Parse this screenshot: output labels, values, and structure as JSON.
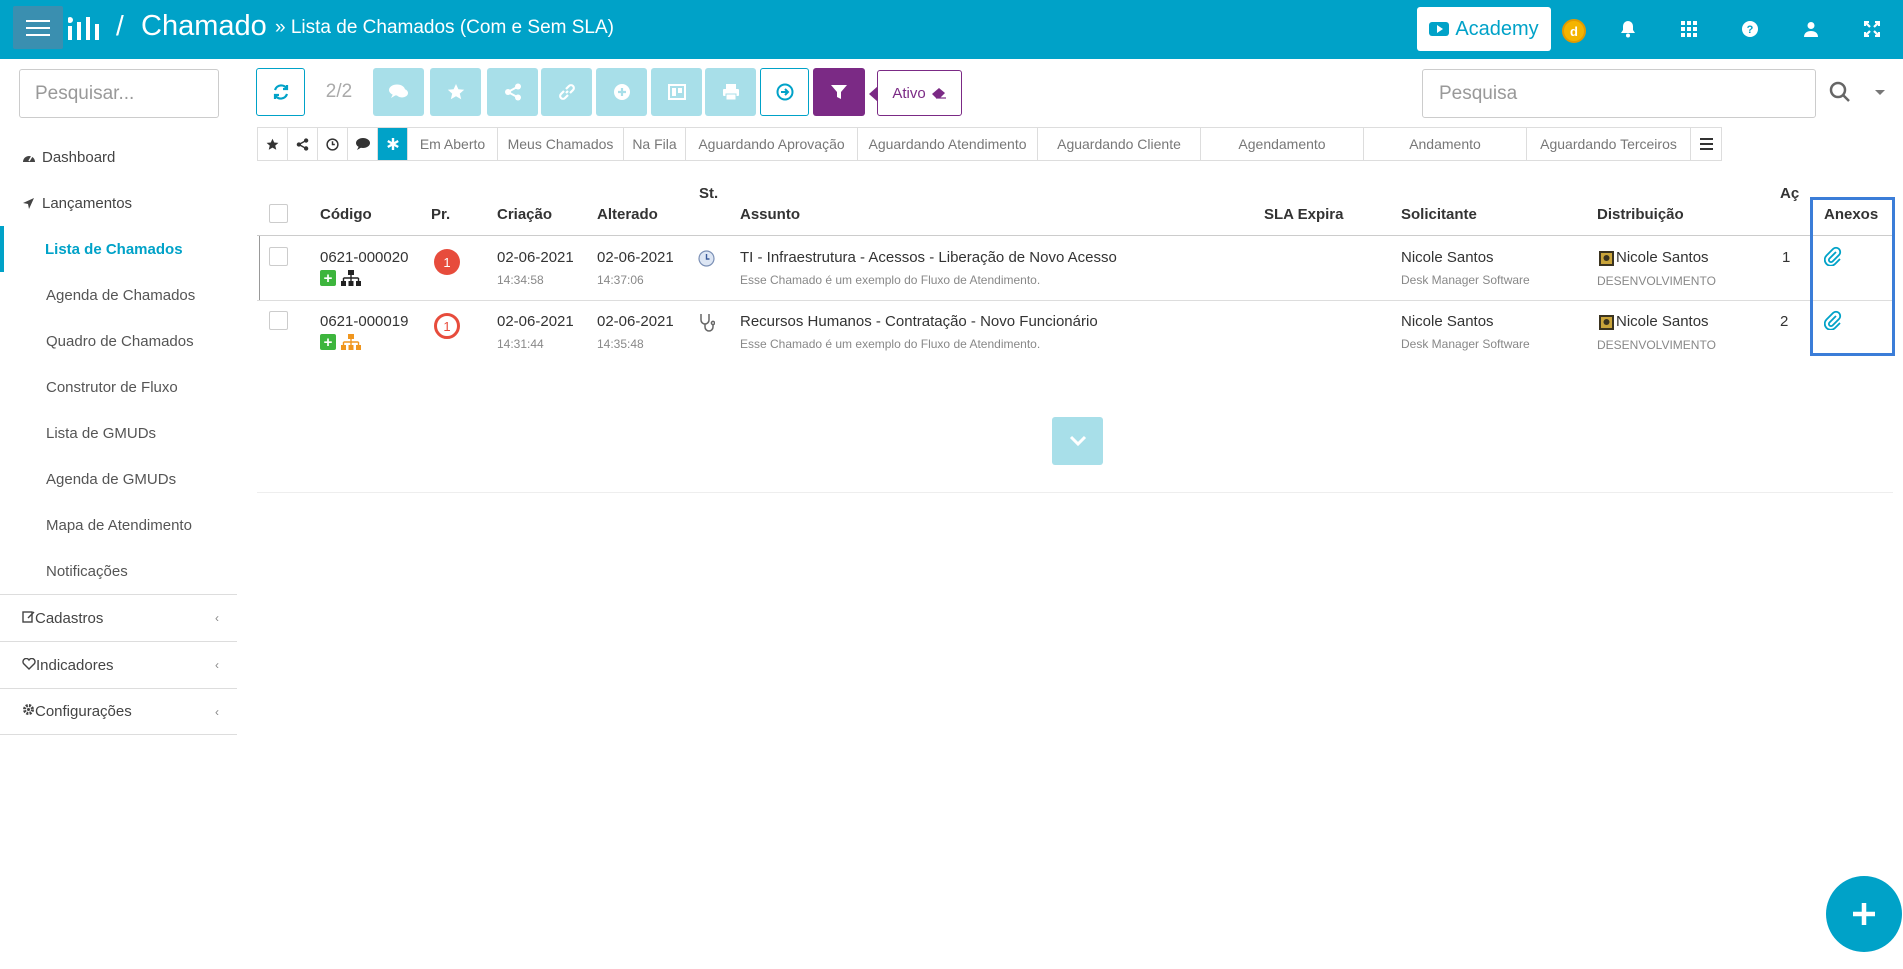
{
  "header": {
    "slash": "/",
    "app_title": "Chamado",
    "breadcrumb": "» Lista de Chamados (Com e Sem SLA)",
    "academy_label": "Academy",
    "coin_label": "d",
    "icons": [
      "bell-icon",
      "grid-icon",
      "question-icon",
      "user-icon",
      "fullscreen-icon"
    ]
  },
  "sidebar": {
    "search_placeholder": "Pesquisar...",
    "dashboard": "Dashboard",
    "lancamentos": "Lançamentos",
    "sub_items": [
      "Lista de Chamados",
      "Agenda de Chamados",
      "Quadro de Chamados",
      "Construtor de Fluxo",
      "Lista de GMUDs",
      "Agenda de GMUDs",
      "Mapa de Atendimento",
      "Notificações"
    ],
    "active_item": "Lista de Chamados",
    "groups": [
      "Cadastros",
      "Indicadores",
      "Configurações"
    ]
  },
  "toolbar": {
    "page_count": "2/2",
    "filter_status": "Ativo",
    "search_placeholder": "Pesquisa"
  },
  "filter_tabs": [
    "Em Aberto",
    "Meus Chamados",
    "Na Fila",
    "Aguardando Aprovação",
    "Aguardando Atendimento",
    "Aguardando Cliente",
    "Agendamento",
    "Andamento",
    "Aguardando Terceiros"
  ],
  "table": {
    "headers": {
      "codigo": "Código",
      "pr": "Pr.",
      "criacao": "Criação",
      "alterado": "Alterado",
      "st": "St.",
      "assunto": "Assunto",
      "sla": "SLA Expira",
      "solicitante": "Solicitante",
      "distribuicao": "Distribuição",
      "ac": "Aç",
      "anexos": "Anexos"
    },
    "rows": [
      {
        "codigo": "0621-000020",
        "prioridade": "1",
        "criacao_data": "02-06-2021",
        "criacao_hora": "14:34:58",
        "alterado_data": "02-06-2021",
        "alterado_hora": "14:37:06",
        "assunto": "TI - Infraestrutura - Acessos - Liberação de Novo Acesso",
        "descricao": "Esse Chamado é um exemplo do Fluxo de Atendimento.",
        "solicitante": "Nicole Santos",
        "empresa": "Desk Manager Software",
        "distribuicao": "Nicole Santos",
        "grupo": "DESENVOLVIMENTO",
        "acoes": "1"
      },
      {
        "codigo": "0621-000019",
        "prioridade": "1",
        "criacao_data": "02-06-2021",
        "criacao_hora": "14:31:44",
        "alterado_data": "02-06-2021",
        "alterado_hora": "14:35:48",
        "assunto": "Recursos Humanos - Contratação - Novo Funcionário",
        "descricao": "Esse Chamado é um exemplo do Fluxo de Atendimento.",
        "solicitante": "Nicole Santos",
        "empresa": "Desk Manager Software",
        "distribuicao": "Nicole Santos",
        "grupo": "DESENVOLVIMENTO",
        "acoes": "2"
      }
    ]
  },
  "colors": {
    "primary": "#00a2c8",
    "primary_light": "#a8dfe9",
    "filter_purple": "#7b2a85",
    "priority_red": "#e74c3c",
    "highlight_blue": "#3b7dd8"
  }
}
